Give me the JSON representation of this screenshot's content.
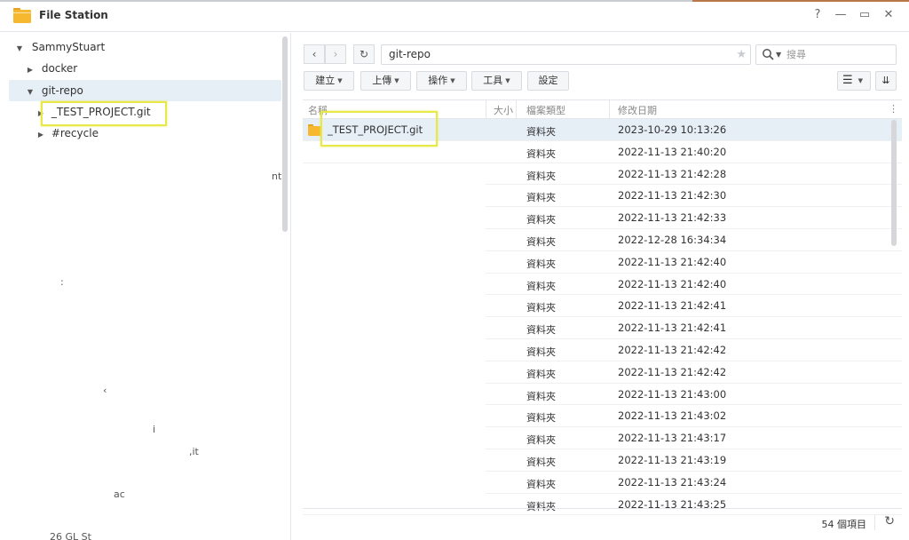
{
  "window": {
    "title": "File Station",
    "controls": [
      "?",
      "—",
      "▭",
      "✕"
    ]
  },
  "tree": {
    "root": "SammyStuart",
    "items": [
      {
        "label": "docker"
      },
      {
        "label": "git-repo"
      },
      {
        "label": "_TEST_PROJECT.git"
      },
      {
        "label": "#recycle"
      }
    ],
    "fragments": [
      "nt",
      ":",
      "‹",
      "i",
      ",it",
      "ac",
      "26  GL  St"
    ]
  },
  "toolbar": {
    "back": "‹",
    "forward": "›",
    "refresh": "↻",
    "path": "git-repo",
    "search_placeholder": "搜尋",
    "buttons": [
      "建立",
      "上傳",
      "操作",
      "工具",
      "設定"
    ]
  },
  "columns": {
    "name": "名稱",
    "size": "大小",
    "type": "檔案類型",
    "modified": "修改日期"
  },
  "rows": [
    {
      "name": "_TEST_PROJECT.git",
      "type": "資料夾",
      "date": "2023-10-29 10:13:26"
    },
    {
      "name": "",
      "type": "資料夾",
      "date": "2022-11-13 21:40:20"
    },
    {
      "name": "",
      "type": "資料夾",
      "date": "2022-11-13 21:42:28"
    },
    {
      "name": "",
      "type": "資料夾",
      "date": "2022-11-13 21:42:30"
    },
    {
      "name": "",
      "type": "資料夾",
      "date": "2022-11-13 21:42:33"
    },
    {
      "name": "",
      "type": "資料夾",
      "date": "2022-12-28 16:34:34"
    },
    {
      "name": "",
      "type": "資料夾",
      "date": "2022-11-13 21:42:40"
    },
    {
      "name": "",
      "type": "資料夾",
      "date": "2022-11-13 21:42:40"
    },
    {
      "name": "",
      "type": "資料夾",
      "date": "2022-11-13 21:42:41"
    },
    {
      "name": "",
      "type": "資料夾",
      "date": "2022-11-13 21:42:41"
    },
    {
      "name": "",
      "type": "資料夾",
      "date": "2022-11-13 21:42:42"
    },
    {
      "name": "",
      "type": "資料夾",
      "date": "2022-11-13 21:42:42"
    },
    {
      "name": "",
      "type": "資料夾",
      "date": "2022-11-13 21:43:00"
    },
    {
      "name": "",
      "type": "資料夾",
      "date": "2022-11-13 21:43:02"
    },
    {
      "name": "",
      "type": "資料夾",
      "date": "2022-11-13 21:43:17"
    },
    {
      "name": "",
      "type": "資料夾",
      "date": "2022-11-13 21:43:19"
    },
    {
      "name": "",
      "type": "資料夾",
      "date": "2022-11-13 21:43:24"
    },
    {
      "name": "",
      "type": "資料夾",
      "date": "2022-11-13 21:43:25"
    }
  ],
  "status": {
    "count": "54 個項目"
  },
  "colors": {
    "folder": "#f5b82e",
    "selection": "#e6eef6",
    "highlight": "#e8e84a"
  }
}
